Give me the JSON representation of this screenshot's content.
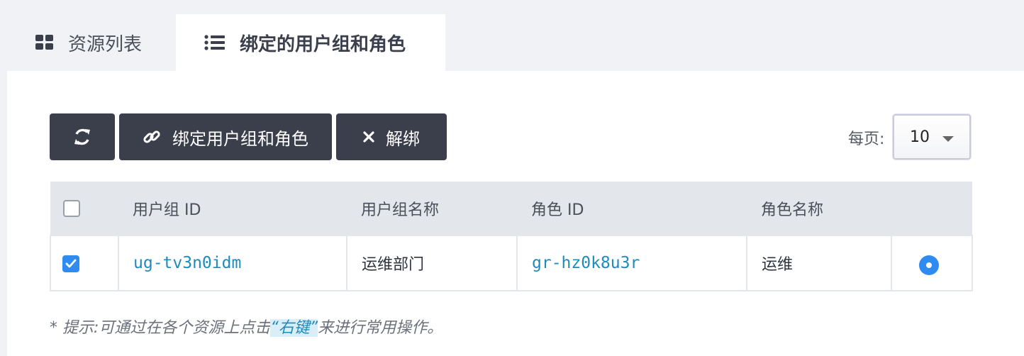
{
  "tabs": [
    {
      "label": "资源列表",
      "icon": "grid-icon"
    },
    {
      "label": "绑定的用户组和角色",
      "icon": "list-icon"
    }
  ],
  "toolbar": {
    "refresh_icon": "refresh-icon",
    "bind_label": "绑定用户组和角色",
    "unbind_label": "解绑"
  },
  "pagination": {
    "per_page_label": "每页:",
    "per_page_value": "10"
  },
  "table": {
    "headers": [
      "用户组 ID",
      "用户组名称",
      "角色 ID",
      "角色名称"
    ],
    "rows": [
      {
        "checked": true,
        "group_id": "ug-tv3n0idm",
        "group_name": "运维部门",
        "role_id": "gr-hz0k8u3r",
        "role_name": "运维"
      }
    ]
  },
  "hint": {
    "prefix": "* 提示:可通过在各个资源上点击",
    "highlight": "“右键”",
    "suffix": "来进行常用操作。"
  },
  "colors": {
    "button_bg": "#3a3f4b",
    "link": "#1f8bbd",
    "accent": "#2f8bf0"
  }
}
